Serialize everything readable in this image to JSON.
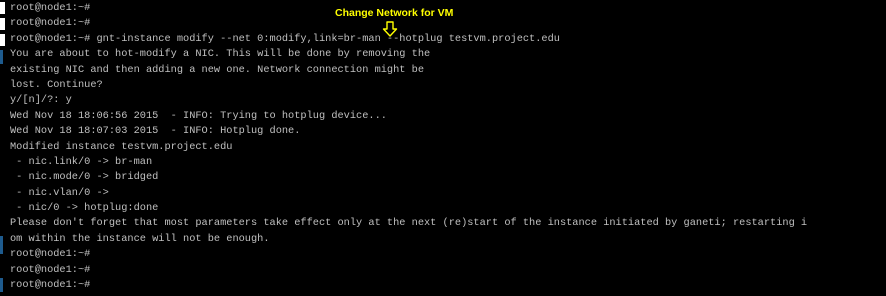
{
  "annotation": {
    "title": "Change Network for VM",
    "arrow_icon": "down-arrow-icon",
    "color": "#ffff00"
  },
  "terminal": {
    "foreground": "#c0c0c0",
    "background": "#000000",
    "lines": [
      "root@node1:~#",
      "root@node1:~#",
      "root@node1:~# gnt-instance modify --net 0:modify,link=br-man --hotplug testvm.project.edu",
      "You are about to hot-modify a NIC. This will be done by removing the",
      "existing NIC and then adding a new one. Network connection might be",
      "lost. Continue?",
      "y/[n]/?: y",
      "Wed Nov 18 18:06:56 2015  - INFO: Trying to hotplug device...",
      "Wed Nov 18 18:07:03 2015  - INFO: Hotplug done.",
      "Modified instance testvm.project.edu",
      " - nic.link/0 -> br-man",
      " - nic.mode/0 -> bridged",
      " - nic.vlan/0 ->",
      " - nic/0 -> hotplug:done",
      "Please don't forget that most parameters take effect only at the next (re)start of the instance initiated by ganeti; restarting i",
      "om within the instance will not be enough.",
      "root@node1:~#",
      "root@node1:~#",
      "root@node1:~#"
    ]
  }
}
